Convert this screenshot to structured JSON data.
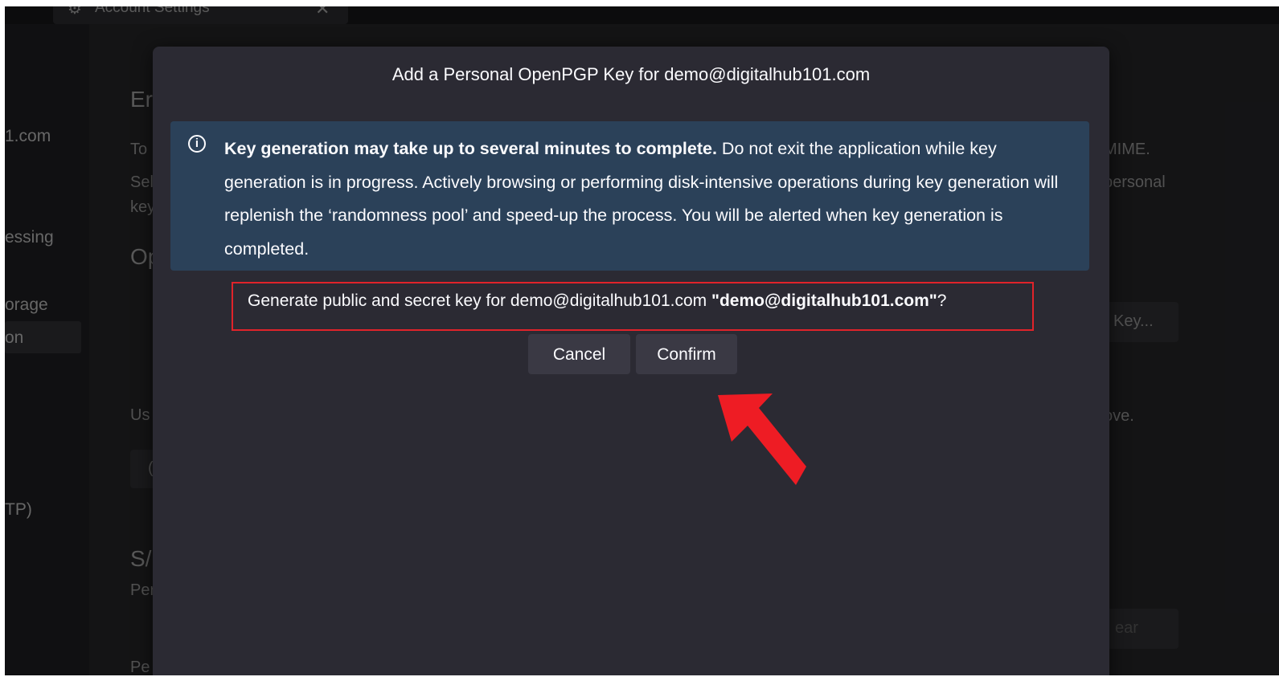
{
  "background_window": {
    "tab_title": "Account Settings",
    "tab_close_glyph": "✕",
    "tab_icon": "gear-icon",
    "sidebar_items": [
      "1.com",
      "essing",
      "orage",
      "on",
      "TP)"
    ],
    "content_fragments": {
      "heading_1": "Er",
      "line_1": "To",
      "line_2": "Sel",
      "line_3": "key",
      "heading_2": "Op",
      "line_4": "Us",
      "line_5": "(",
      "heading_3": "S/",
      "line_6": "Per",
      "line_7": "Pe",
      "right_1": "MIME.",
      "right_2": "personal",
      "right_button": "Key...",
      "right_3": "ove.",
      "right_button_2": "ear"
    }
  },
  "dialog": {
    "title": "Add a Personal OpenPGP Key for demo@digitalhub101.com",
    "info": {
      "icon": "info-icon",
      "bold_text": "Key generation may take up to several minutes to complete.",
      "text": " Do not exit the application while key generation is in progress. Actively browsing or performing disk-intensive operations during key generation will replenish the ‘randomness pool’ and speed-up the process. You will be alerted when key generation is completed."
    },
    "prompt": {
      "text": "Generate public and secret key for demo@digitalhub101.com ",
      "bold_text": "\"demo@digitalhub101.com\"",
      "suffix": "?"
    },
    "buttons": {
      "cancel_label": "Cancel",
      "confirm_label": "Confirm"
    }
  },
  "annotation": {
    "arrow_color": "#ee1c24"
  }
}
